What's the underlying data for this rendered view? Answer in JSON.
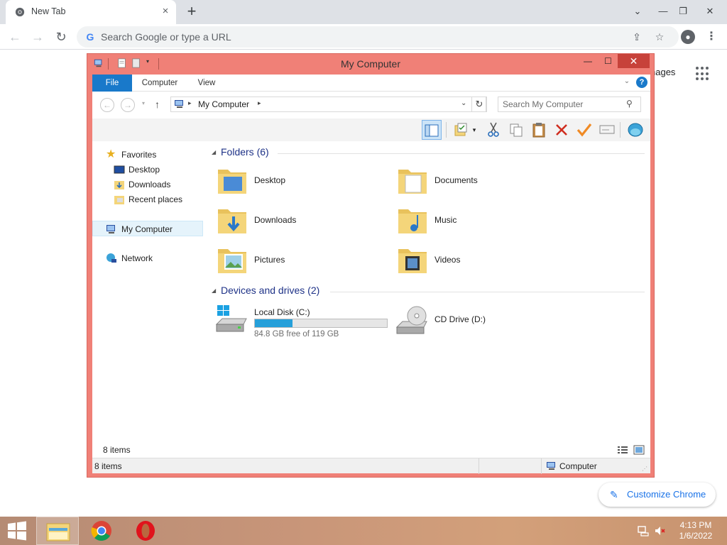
{
  "browser": {
    "tab_title": "New Tab",
    "tab_close": "×",
    "new_tab": "+",
    "omnibox_placeholder": "Search Google or type a URL",
    "images_link": "nages",
    "customize_label": "Customize Chrome"
  },
  "explorer": {
    "title": "My Computer",
    "ribbon_tabs": [
      "File",
      "Computer",
      "View"
    ],
    "breadcrumb": "My Computer",
    "search_placeholder": "Search My Computer",
    "nav_pane": {
      "favorites": "Favorites",
      "desktop": "Desktop",
      "downloads": "Downloads",
      "recent": "Recent places",
      "my_computer": "My Computer",
      "network": "Network"
    },
    "folders_header": "Folders (6)",
    "folders": [
      "Desktop",
      "Documents",
      "Downloads",
      "Music",
      "Pictures",
      "Videos"
    ],
    "devices_header": "Devices and drives (2)",
    "drives": [
      {
        "name": "Local Disk (C:)",
        "free_text": "84.8 GB free of 119 GB",
        "used_fraction": 0.287
      },
      {
        "name": "CD Drive (D:)"
      }
    ],
    "items_count_inner": "8 items",
    "status_count": "8 items",
    "status_location": "Computer"
  },
  "taskbar": {
    "time": "4:13 PM",
    "date": "1/6/2022"
  },
  "colors": {
    "window_frame": "#f08077",
    "close_button": "#c7423a",
    "file_tab": "#1979ca",
    "header_text": "#1e3287",
    "drive_bar": "#26a0da"
  }
}
